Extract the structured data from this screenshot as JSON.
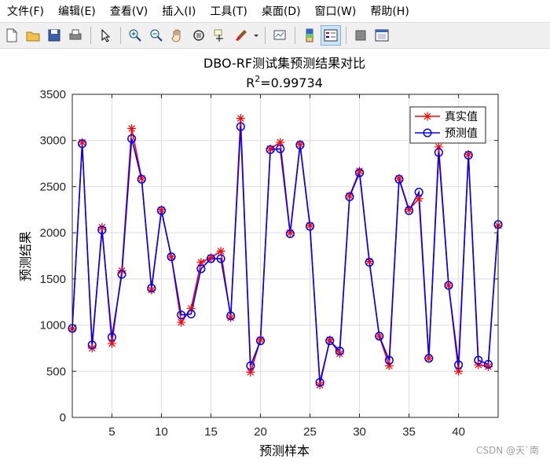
{
  "menu": {
    "items": [
      "文件(F)",
      "编辑(E)",
      "查看(V)",
      "插入(I)",
      "工具(T)",
      "桌面(D)",
      "窗口(W)",
      "帮助(H)"
    ]
  },
  "toolbar": {
    "icons": [
      "new-file-icon",
      "open-folder-icon",
      "save-icon",
      "print-icon",
      "select-arrow-icon",
      "zoom-in-icon",
      "zoom-out-icon",
      "pan-hand-icon",
      "rotate-3d-icon",
      "data-cursor-icon",
      "brush-icon",
      "link-plot-icon",
      "colorbar-icon",
      "legend-icon",
      "hide-plot-tools-icon",
      "show-plot-tools-icon"
    ]
  },
  "watermark": "CSDN @天`南",
  "colors": {
    "series1": "#ff0000",
    "series2": "#0000ff"
  },
  "chart_data": {
    "type": "line",
    "title": "DBO-RF测试集预测结果对比",
    "subtitle_prefix": "R",
    "subtitle_sup": "2",
    "subtitle_suffix": "=0.99734",
    "xlabel": "预测样本",
    "ylabel": "预测结果",
    "xlim": [
      1,
      44
    ],
    "ylim": [
      0,
      3500
    ],
    "xticks": [
      5,
      10,
      15,
      20,
      25,
      30,
      35,
      40
    ],
    "yticks": [
      0,
      500,
      1000,
      1500,
      2000,
      2500,
      3000,
      3500
    ],
    "grid": true,
    "legend_position": "top-right",
    "x": [
      1,
      2,
      3,
      4,
      5,
      6,
      7,
      8,
      9,
      10,
      11,
      12,
      13,
      14,
      15,
      16,
      17,
      18,
      19,
      20,
      21,
      22,
      23,
      24,
      25,
      26,
      27,
      28,
      29,
      30,
      31,
      32,
      33,
      34,
      35,
      36,
      37,
      38,
      39,
      40,
      41,
      42,
      43,
      44
    ],
    "series": [
      {
        "name": "真实值",
        "marker": "star",
        "color": "#ff0000",
        "values": [
          960,
          2980,
          750,
          2060,
          800,
          1590,
          3130,
          2590,
          1380,
          2250,
          1740,
          1030,
          1180,
          1680,
          1730,
          1800,
          1080,
          3240,
          490,
          840,
          2910,
          2980,
          2000,
          2960,
          2080,
          350,
          840,
          690,
          2400,
          2670,
          1690,
          880,
          560,
          2590,
          2250,
          2370,
          640,
          2930,
          1430,
          500,
          2850,
          570,
          550,
          2080
        ]
      },
      {
        "name": "预测值",
        "marker": "circle",
        "color": "#0000ff",
        "values": [
          965,
          2965,
          785,
          2030,
          870,
          1550,
          3020,
          2580,
          1400,
          2240,
          1740,
          1110,
          1120,
          1610,
          1720,
          1720,
          1100,
          3150,
          560,
          830,
          2900,
          2910,
          1990,
          2950,
          2070,
          380,
          830,
          720,
          2390,
          2650,
          1680,
          880,
          620,
          2580,
          2240,
          2440,
          640,
          2870,
          1430,
          570,
          2840,
          620,
          575,
          2090
        ]
      }
    ]
  }
}
